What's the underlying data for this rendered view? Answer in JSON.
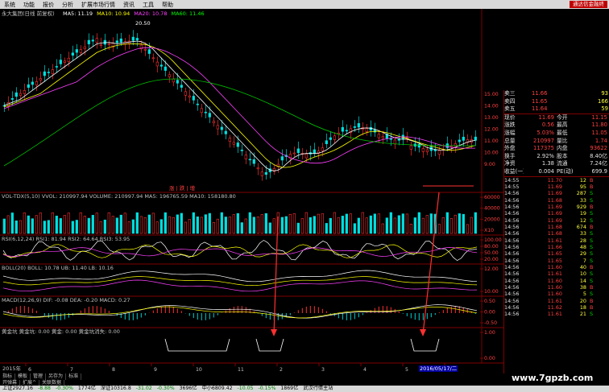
{
  "menu": {
    "items": [
      "系统",
      "功能",
      "报价",
      "分析",
      "扩展市场行情",
      "资讯",
      "工具",
      "帮助"
    ],
    "ad": "通达信金融终"
  },
  "main_chart": {
    "title": "永大集团(日线 前复权)",
    "ma_labels": [
      {
        "text": "MA5: 11.19",
        "color": "#ffffff"
      },
      {
        "text": "MA10: 10.94",
        "color": "#ffff00"
      },
      {
        "text": "MA20: 10.78",
        "color": "#ff40ff"
      },
      {
        "text": "MA60: 11.46",
        "color": "#00ff00"
      }
    ],
    "high_label": "20.50",
    "price_axis": [
      "15.00",
      "14.00",
      "13.00",
      "12.00",
      "11.00",
      "10.00",
      "9.00"
    ],
    "annotation": "涨 | 跌 | 增"
  },
  "vol_panel": {
    "label": "VOL-TDX(5,10) VVOL: 210997.94  VOLUME: 210997.94  MA5: 196765.59  MA10: 158180.80",
    "axis": [
      "60000",
      "40000",
      "20000",
      "X10"
    ]
  },
  "rsi_panel": {
    "label": "RSI(6,12,24) RSI1: 81.94  RSI2: 64.64  RSI3: 53.95",
    "axis": [
      "100.00",
      "80.00",
      "50.00",
      "20.00"
    ]
  },
  "boll_panel": {
    "label": "BOLL(20) BOLL: 10.78  UB: 11.40  LB: 10.16",
    "axis": [
      "12.00",
      "10.00"
    ]
  },
  "macd_panel": {
    "label": "MACD(12,26,9) DIF: -0.08  DEA: -0.20  MACD: 0.27",
    "axis": [
      "0.50",
      "0.00",
      "-0.50"
    ]
  },
  "gold_panel": {
    "label": "黄金坑  黄金坑: 0.00  黄金: 0.00  黄金坑消失: 0.00",
    "axis": [
      "1.00",
      "0.00"
    ]
  },
  "date_axis": {
    "left_label": "2015年",
    "ticks": [
      "6",
      "7",
      "8",
      "9",
      "10",
      "11",
      "2",
      "3",
      "4",
      "5",
      "6"
    ],
    "highlight": "2016/05/17/二"
  },
  "quote": {
    "asks": [
      {
        "name": "卖三",
        "price": "11.66",
        "vol": "93"
      },
      {
        "name": "卖四",
        "price": "11.65",
        "vol": "166"
      },
      {
        "name": "卖五",
        "price": "11.64",
        "vol": "59"
      }
    ],
    "rows": [
      {
        "k1": "现价",
        "v1": "11.69",
        "k2": "今开",
        "v2": "11.15"
      },
      {
        "k1": "涨跌",
        "v1": "0.56",
        "k2": "最高",
        "v2": "11.80"
      },
      {
        "k1": "涨幅",
        "v1": "5.03%",
        "k2": "最低",
        "v2": "11.05"
      },
      {
        "k1": "总量",
        "v1": "210997",
        "k2": "量比",
        "v2": "1.74"
      },
      {
        "k1": "外盘",
        "v1": "117375",
        "k2": "内盘",
        "v2": "93622"
      },
      {
        "k1": "换手",
        "v1": "2.92%",
        "k2": "股本",
        "v2": "8.40亿"
      },
      {
        "k1": "净资",
        "v1": "1.38",
        "k2": "流通",
        "v2": "7.24亿"
      },
      {
        "k1": "收益(一)",
        "v1": "0.004",
        "k2": "PE(动)",
        "v2": "699.9"
      }
    ]
  },
  "ticks": [
    {
      "time": "14:55",
      "price": "11.70",
      "vol": "12",
      "side": "B"
    },
    {
      "time": "14:55",
      "price": "11.69",
      "vol": "95",
      "side": "B"
    },
    {
      "time": "14:56",
      "price": "11.69",
      "vol": "287",
      "side": "S"
    },
    {
      "time": "14:56",
      "price": "11.68",
      "vol": "33",
      "side": "S"
    },
    {
      "time": "14:56",
      "price": "11.69",
      "vol": "929",
      "side": "B"
    },
    {
      "time": "14:56",
      "price": "11.69",
      "vol": "19",
      "side": "S"
    },
    {
      "time": "14:56",
      "price": "11.69",
      "vol": "12",
      "side": "S"
    },
    {
      "time": "14:56",
      "price": "11.68",
      "vol": "674",
      "side": "B"
    },
    {
      "time": "14:56",
      "price": "11.68",
      "vol": "33",
      "side": "S"
    },
    {
      "time": "14:56",
      "price": "11.61",
      "vol": "28",
      "side": "S"
    },
    {
      "time": "14:56",
      "price": "11.66",
      "vol": "48",
      "side": "S"
    },
    {
      "time": "14:56",
      "price": "11.65",
      "vol": "29",
      "side": "S"
    },
    {
      "time": "14:56",
      "price": "11.65",
      "vol": "7",
      "side": "S"
    },
    {
      "time": "14:56",
      "price": "11.60",
      "vol": "40",
      "side": "B"
    },
    {
      "time": "14:56",
      "price": "11.61",
      "vol": "10",
      "side": "S"
    },
    {
      "time": "14:56",
      "price": "11.60",
      "vol": "14",
      "side": "S"
    },
    {
      "time": "14:56",
      "price": "11.60",
      "vol": "38",
      "side": "B"
    },
    {
      "time": "14:56",
      "price": "11.60",
      "vol": "5",
      "side": "S"
    },
    {
      "time": "14:56",
      "price": "11.61",
      "vol": "20",
      "side": "B"
    },
    {
      "time": "14:56",
      "price": "11.62",
      "vol": "18",
      "side": "B"
    },
    {
      "time": "14:56",
      "price": "11.61",
      "vol": "21",
      "side": "S"
    }
  ],
  "bottom_tabs": [
    "指标",
    "模板",
    "管理",
    "另存为",
    "标准"
  ],
  "bottom_tabs2": [
    "开弹幕",
    "扩展^",
    "关联数据"
  ],
  "status": [
    {
      "text": "上证2927.16",
      "color": "#000000"
    },
    {
      "text": "-8.88",
      "color": "#008000"
    },
    {
      "text": "-0.30%",
      "color": "#008000"
    },
    {
      "text": "1774亿",
      "color": "#000000"
    },
    {
      "text": "深证10316.8",
      "color": "#000000"
    },
    {
      "text": "-31.02",
      "color": "#008000"
    },
    {
      "text": "-0.30%",
      "color": "#008000"
    },
    {
      "text": "3696亿",
      "color": "#000000"
    },
    {
      "text": "中小6809.42",
      "color": "#000000"
    },
    {
      "text": "-10.05",
      "color": "#008000"
    },
    {
      "text": "-0.15%",
      "color": "#008000"
    },
    {
      "text": "1869亿",
      "color": "#000000"
    },
    {
      "text": "武汉行情主站",
      "color": "#000000"
    }
  ],
  "watermark": "www.7gpzb.com"
}
